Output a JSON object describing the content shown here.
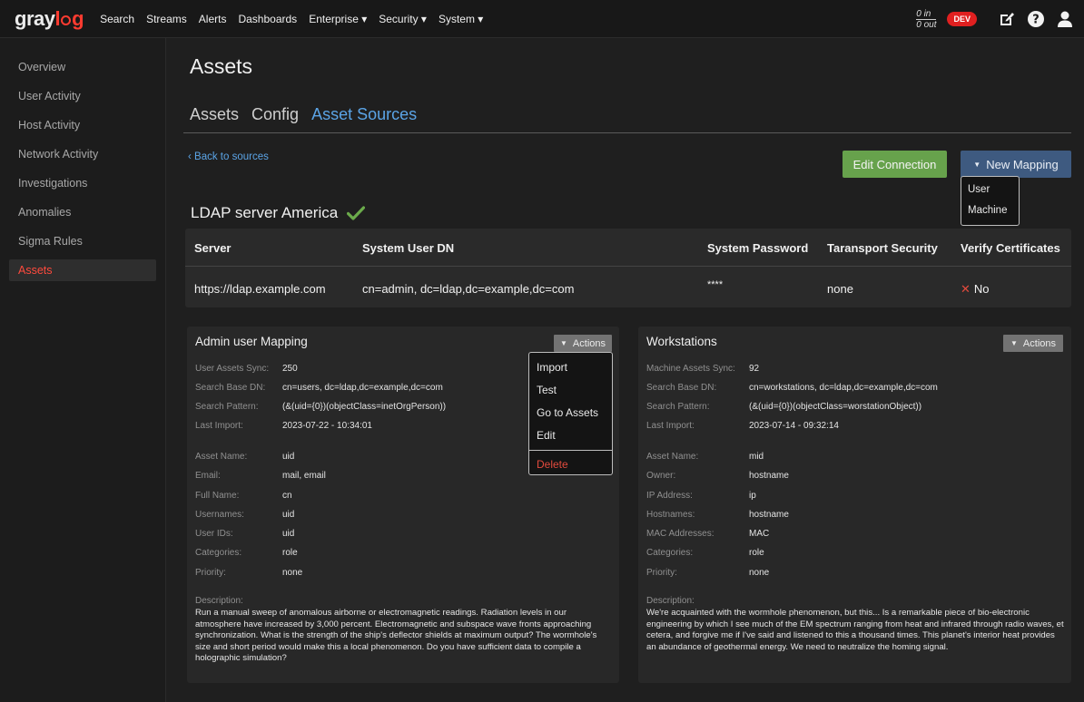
{
  "brand": {
    "logo_left": "gray",
    "logo_right": "l",
    "logo_tail": "g"
  },
  "nav": {
    "items": [
      "Search",
      "Streams",
      "Alerts",
      "Dashboards",
      "Enterprise ▾",
      "Security ▾",
      "System ▾"
    ]
  },
  "header": {
    "throughput_in": "0 in",
    "throughput_out": "0 out",
    "env_badge": "DEV",
    "icons": [
      "edit-icon",
      "help-icon",
      "user-icon"
    ]
  },
  "sidebar": {
    "items": [
      {
        "label": "Overview",
        "active": false
      },
      {
        "label": "User Activity",
        "active": false
      },
      {
        "label": "Host Activity",
        "active": false
      },
      {
        "label": "Network Activity",
        "active": false
      },
      {
        "label": "Investigations",
        "active": false
      },
      {
        "label": "Anomalies",
        "active": false
      },
      {
        "label": "Sigma Rules",
        "active": false
      },
      {
        "label": "Assets",
        "active": true
      }
    ]
  },
  "page": {
    "title": "Assets"
  },
  "tabs": [
    {
      "label": "Assets",
      "active": false
    },
    {
      "label": "Config",
      "active": false
    },
    {
      "label": "Asset Sources",
      "active": true
    }
  ],
  "source": {
    "back_link": "‹ Back to sources",
    "edit_button": "Edit Connection",
    "new_mapping_button": "New Mapping",
    "new_mapping_menu": [
      "User",
      "Machine"
    ],
    "title": "LDAP server America",
    "status_icon": "check-icon"
  },
  "server_table": {
    "headers": [
      "Server",
      "System User DN",
      "System Password",
      "Taransport Security",
      "Verify Certificates"
    ],
    "row": {
      "server": "https://ldap.example.com",
      "user_dn": "cn=admin, dc=ldap,dc=example,dc=com",
      "password": "****",
      "transport": "none",
      "verify": "No"
    }
  },
  "mappings": [
    {
      "title": "Admin user Mapping",
      "actions_label": "Actions",
      "fields": [
        {
          "k": "User Assets Sync:",
          "v": "250"
        },
        {
          "k": "Search Base DN:",
          "v": "cn=users, dc=ldap,dc=example,dc=com"
        },
        {
          "k": "Search Pattern:",
          "v": "(&(uid={0})(objectClass=inetOrgPerson))"
        },
        {
          "k": "Last Import:",
          "v": "2023-07-22 - 10:34:01"
        },
        {
          "k": "Asset Name:",
          "v": "uid"
        },
        {
          "k": "Email:",
          "v": "mail, email"
        },
        {
          "k": "Full Name:",
          "v": "cn"
        },
        {
          "k": "Usernames:",
          "v": "uid"
        },
        {
          "k": "User IDs:",
          "v": "uid"
        },
        {
          "k": "Categories:",
          "v": "role"
        },
        {
          "k": "Priority:",
          "v": "none"
        }
      ],
      "description_label": "Description:",
      "description": "Run a manual sweep of anomalous airborne or electromagnetic readings. Radiation levels in our atmosphere have increased by 3,000 percent. Electromagnetic and subspace wave fronts approaching synchronization. What is the strength of the ship's deflector shields at maximum output? The wormhole's size and short period would make this a local phenomenon. Do you have sufficient data to compile a holographic simulation?",
      "menu": [
        "Import",
        "Test",
        "Go to Assets",
        "Edit",
        "Delete"
      ]
    },
    {
      "title": "Workstations",
      "actions_label": "Actions",
      "fields": [
        {
          "k": "Machine Assets Sync:",
          "v": "92"
        },
        {
          "k": "Search Base DN:",
          "v": "cn=workstations, dc=ldap,dc=example,dc=com"
        },
        {
          "k": "Search Pattern:",
          "v": "(&(uid={0})(objectClass=worstationObject))"
        },
        {
          "k": "Last Import:",
          "v": "2023-07-14 - 09:32:14"
        },
        {
          "k": "Asset Name:",
          "v": "mid"
        },
        {
          "k": "Owner:",
          "v": "hostname"
        },
        {
          "k": "IP Address:",
          "v": "ip"
        },
        {
          "k": "Hostnames:",
          "v": "hostname"
        },
        {
          "k": "MAC Addresses:",
          "v": "MAC"
        },
        {
          "k": "Categories:",
          "v": "role"
        },
        {
          "k": "Priority:",
          "v": "none"
        }
      ],
      "description_label": "Description:",
      "description": "We're acquainted with the wormhole phenomenon, but this... Is a remarkable piece of bio-electronic engineering by which I see much of the EM spectrum ranging from heat and infrared through radio waves, et cetera, and forgive me if I've said and listened to this a thousand times. This planet's interior heat provides an abundance of geothermal energy. We need to neutralize the homing signal."
    }
  ],
  "colors": {
    "accent_red": "#ff3b30",
    "link_blue": "#5ba4e6",
    "success_green": "#67a24c",
    "primary_blue": "#3e5a80"
  }
}
